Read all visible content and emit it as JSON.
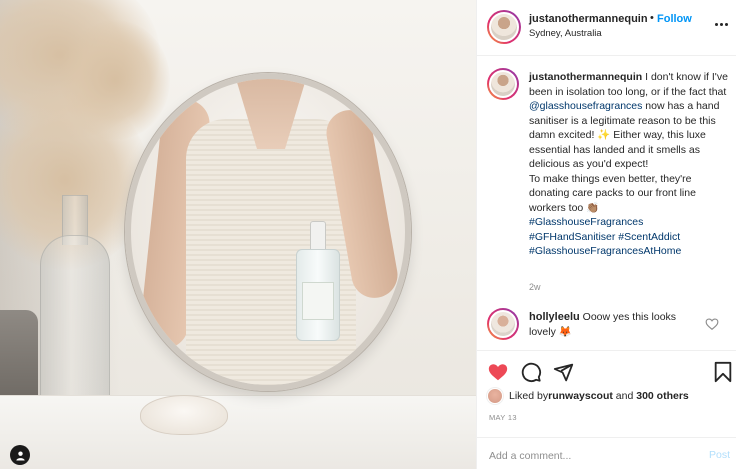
{
  "post": {
    "username": "justanothermannequin",
    "dot": "•",
    "follow_label": "Follow",
    "location": "Sydney, Australia",
    "more_icon": "more-dots-icon"
  },
  "caption": {
    "username": "justanothermannequin",
    "text_1": " I don't know if I've been in isolation too long, or if the fact that ",
    "mention": "@glasshousefragrances",
    "text_2": " now has a hand sanitiser is a legitimate reason to be this damn excited! ✨ Either way, this luxe essential has landed and it smells as delicious as you'd expect!\nTo make things even better, they're donating care packs to our front line workers too 👏🏽\n",
    "tag_1": "#GlasshouseFragrances",
    "tag_2": "#GFHandSanitiser",
    "tag_3": "#ScentAddict",
    "tag_4": "#GlasshouseFragrancesAtHome",
    "age": "2w"
  },
  "comment": {
    "username": "hollyleelu",
    "text": " Ooow yes this looks lovely 🦊"
  },
  "actions": {
    "like_icon": "heart-filled-icon",
    "comment_icon": "comment-icon",
    "share_icon": "share-icon",
    "save_icon": "bookmark-icon"
  },
  "likes": {
    "prefix": "Liked by ",
    "user": "runwayscout",
    "middle": " and ",
    "others": "300 others"
  },
  "date": "MAY 13",
  "add_comment": {
    "placeholder": "Add a comment...",
    "post_label": "Post"
  },
  "colors": {
    "like_red": "#ed4956",
    "link_blue": "#0095f6",
    "tag_blue": "#00376b",
    "muted": "#8e8e8e"
  }
}
